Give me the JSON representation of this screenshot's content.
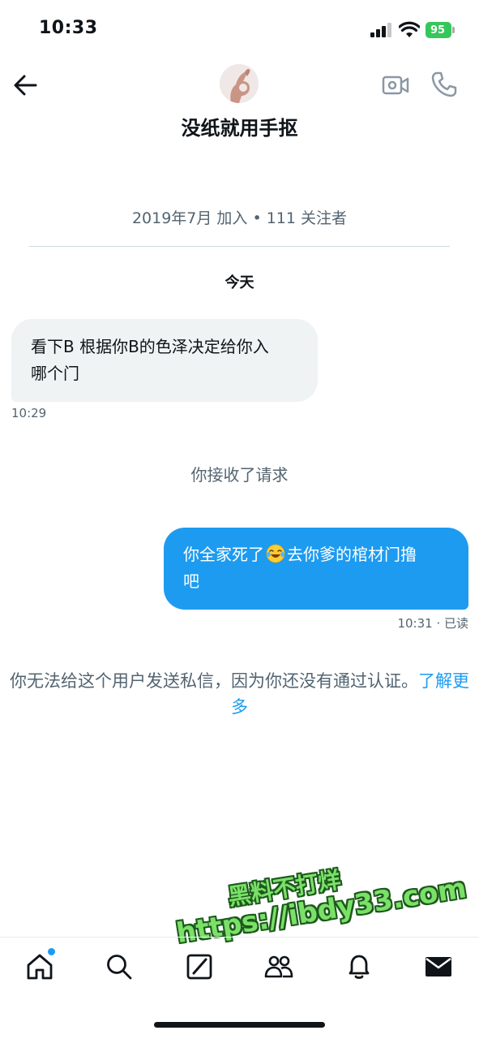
{
  "status_bar": {
    "time": "10:33",
    "battery": "95",
    "icons": [
      "signal-icon",
      "wifi-icon",
      "battery-icon"
    ]
  },
  "header": {
    "contact_name": "没纸就用手抠",
    "icons": [
      "back-arrow-icon",
      "video-call-icon",
      "phone-call-icon"
    ]
  },
  "profile_meta": "2019年7月 加入 • 111 关注者",
  "date_label": "今天",
  "messages": [
    {
      "direction": "incoming",
      "lines": [
        "看下B 根据你B的色泽决定给你入",
        "哪个门"
      ],
      "time": "10:29"
    },
    {
      "direction": "outgoing",
      "text_before_emoji": "你全家死了",
      "emoji": "face-with-tears-of-joy",
      "text_after_emoji": "去你爹的棺材门撸",
      "text_line2": "吧",
      "time": "10:31 · 已读"
    }
  ],
  "system_message": "你接收了请求",
  "notice": {
    "text": "你无法给这个用户发送私信，因为你还没有通过认证。",
    "link": "了解更多"
  },
  "watermark": {
    "line1": "黑料不打烊",
    "line2": "https://ibdy33.com"
  },
  "tab_bar": {
    "tabs": [
      "home",
      "search",
      "compose",
      "communities",
      "notifications",
      "messages"
    ],
    "active": "messages"
  },
  "colors": {
    "accent": "#1d9bf0",
    "incoming_bubble": "#eff3f4",
    "secondary_text": "#536471",
    "battery": "#34c759",
    "watermark": "#7be068"
  }
}
